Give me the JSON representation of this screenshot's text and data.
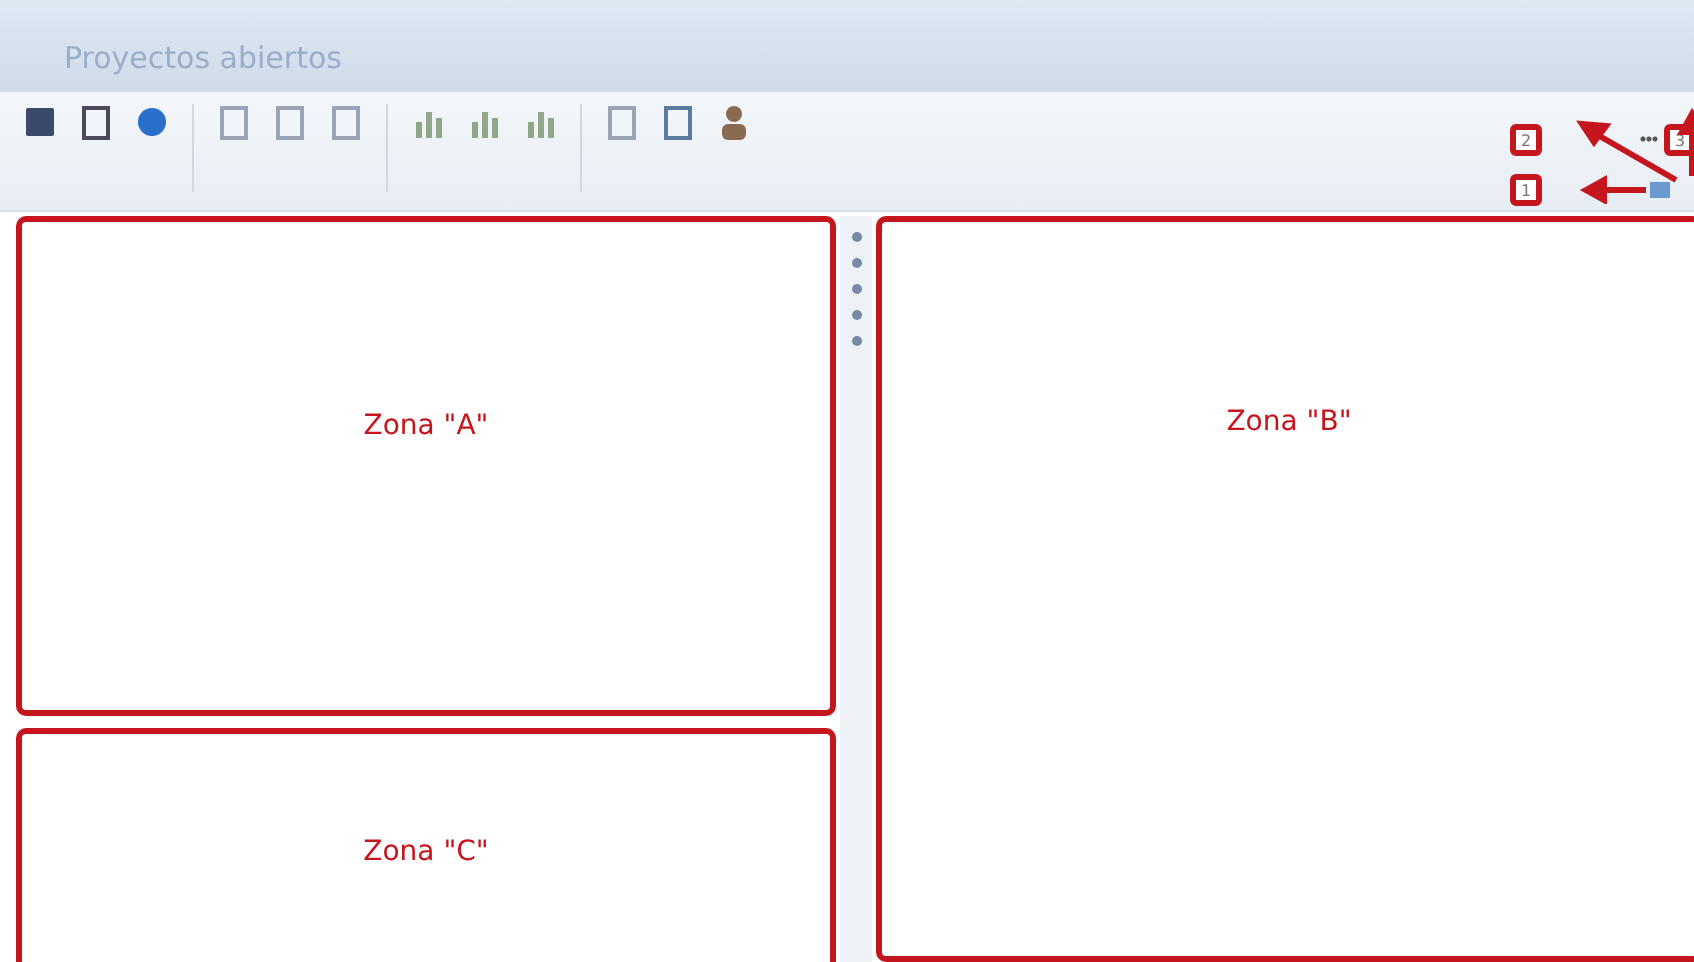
{
  "window": {
    "title": "Proyectos abiertos"
  },
  "callouts": [
    {
      "label": "2"
    },
    {
      "label": "3"
    },
    {
      "label": "1"
    }
  ],
  "zones": [
    {
      "label": "Zona \"A\""
    },
    {
      "label": "Zona \"B\""
    },
    {
      "label": "Zona \"C\""
    }
  ]
}
